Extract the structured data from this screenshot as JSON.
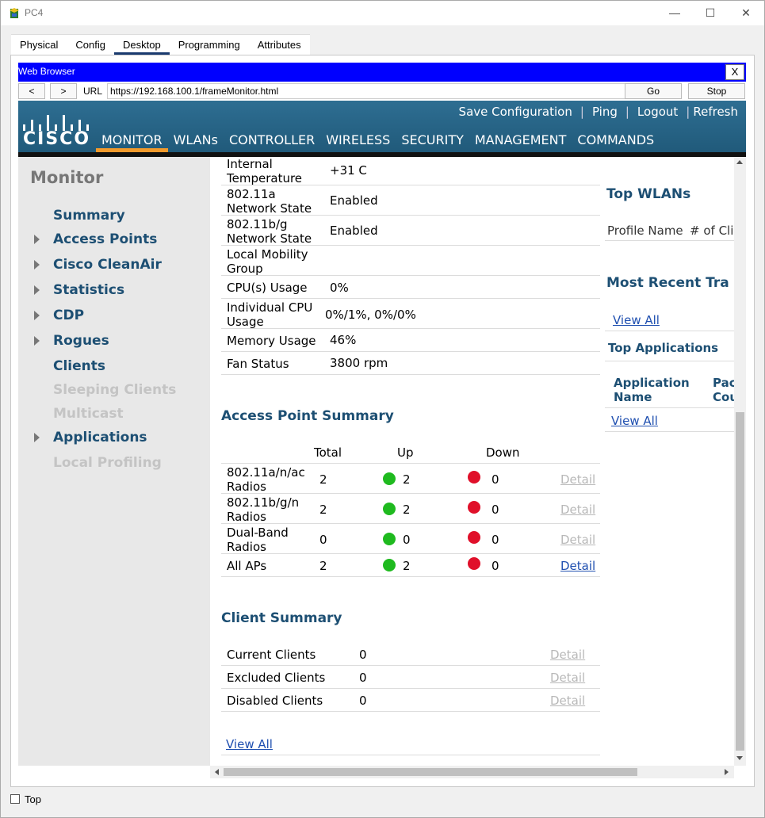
{
  "window": {
    "title": "PC4",
    "minimize": "—",
    "maximize": "☐",
    "close": "✕"
  },
  "tabs": [
    "Physical",
    "Config",
    "Desktop",
    "Programming",
    "Attributes"
  ],
  "browser": {
    "title": "Web Browser",
    "close": "X",
    "back": "<",
    "forward": ">",
    "url_label": "URL",
    "url": "https://192.168.100.1/frameMonitor.html",
    "go": "Go",
    "stop": "Stop"
  },
  "cisco": {
    "logo": "CISCO",
    "top_links": [
      "Save Configuration",
      "Ping",
      "Logout",
      "Refresh"
    ],
    "nav": [
      "MONITOR",
      "WLANs",
      "CONTROLLER",
      "WIRELESS",
      "SECURITY",
      "MANAGEMENT",
      "COMMANDS"
    ]
  },
  "sidebar": {
    "title": "Monitor",
    "items": [
      {
        "label": "Summary"
      },
      {
        "label": "Access Points"
      },
      {
        "label": "Cisco CleanAir"
      },
      {
        "label": "Statistics"
      },
      {
        "label": "CDP"
      },
      {
        "label": "Rogues"
      },
      {
        "label": "Clients"
      },
      {
        "label": "Sleeping Clients"
      },
      {
        "label": "Multicast"
      },
      {
        "label": "Applications"
      },
      {
        "label": "Local Profiling"
      }
    ]
  },
  "system": {
    "rows": [
      {
        "label1": "Internal",
        "label2": "Temperature",
        "value": "+31 C"
      },
      {
        "label1": "802.11a",
        "label2": "Network State",
        "value": "Enabled"
      },
      {
        "label1": "802.11b/g",
        "label2": "Network State",
        "value": "Enabled"
      },
      {
        "label1": "Local Mobility",
        "label2": "Group",
        "value": ""
      },
      {
        "label1": "CPU(s) Usage",
        "label2": "",
        "value": "0%"
      },
      {
        "label1": "Individual CPU",
        "label2": "Usage",
        "value": "0%/1%, 0%/0%"
      },
      {
        "label1": "Memory Usage",
        "label2": "",
        "value": "46%"
      },
      {
        "label1": "Fan Status",
        "label2": "",
        "value": "3800 rpm"
      }
    ]
  },
  "ap_summary": {
    "title": "Access Point Summary",
    "headers": [
      "Total",
      "Up",
      "Down"
    ],
    "rows": [
      {
        "label1": "802.11a/n/ac",
        "label2": "Radios",
        "total": "2",
        "up": "2",
        "down": "0",
        "detail": "Detail",
        "detail_enabled": false
      },
      {
        "label1": "802.11b/g/n",
        "label2": "Radios",
        "total": "2",
        "up": "2",
        "down": "0",
        "detail": "Detail",
        "detail_enabled": false
      },
      {
        "label1": "Dual-Band",
        "label2": "Radios",
        "total": "0",
        "up": "0",
        "down": "0",
        "detail": "Detail",
        "detail_enabled": false
      },
      {
        "label1": "All APs",
        "label2": "",
        "total": "2",
        "up": "2",
        "down": "0",
        "detail": "Detail",
        "detail_enabled": true
      }
    ]
  },
  "client_summary": {
    "title": "Client Summary",
    "rows": [
      {
        "label": "Current Clients",
        "value": "0",
        "detail": "Detail"
      },
      {
        "label": "Excluded Clients",
        "value": "0",
        "detail": "Detail"
      },
      {
        "label": "Disabled Clients",
        "value": "0",
        "detail": "Detail"
      }
    ],
    "view_all": "View All"
  },
  "right": {
    "top_wlans": "Top WLANs",
    "profile_name": "Profile Name",
    "num_clients": "# of Cli",
    "most_recent": "Most Recent Tra",
    "view_all_1": "View All",
    "top_apps": "Top Applications",
    "app_name_1": "Application",
    "app_name_2": "Name",
    "packet_1": "Pac",
    "packet_2": "Cou",
    "view_all_2": "View All"
  },
  "footer": {
    "top_label": "Top"
  },
  "colors": {
    "accent_blue": "#0000ff",
    "cisco_header": "#2e6e92",
    "nav_active": "#f19a2c",
    "up_green": "#1fba1f",
    "down_red": "#e0102a"
  }
}
